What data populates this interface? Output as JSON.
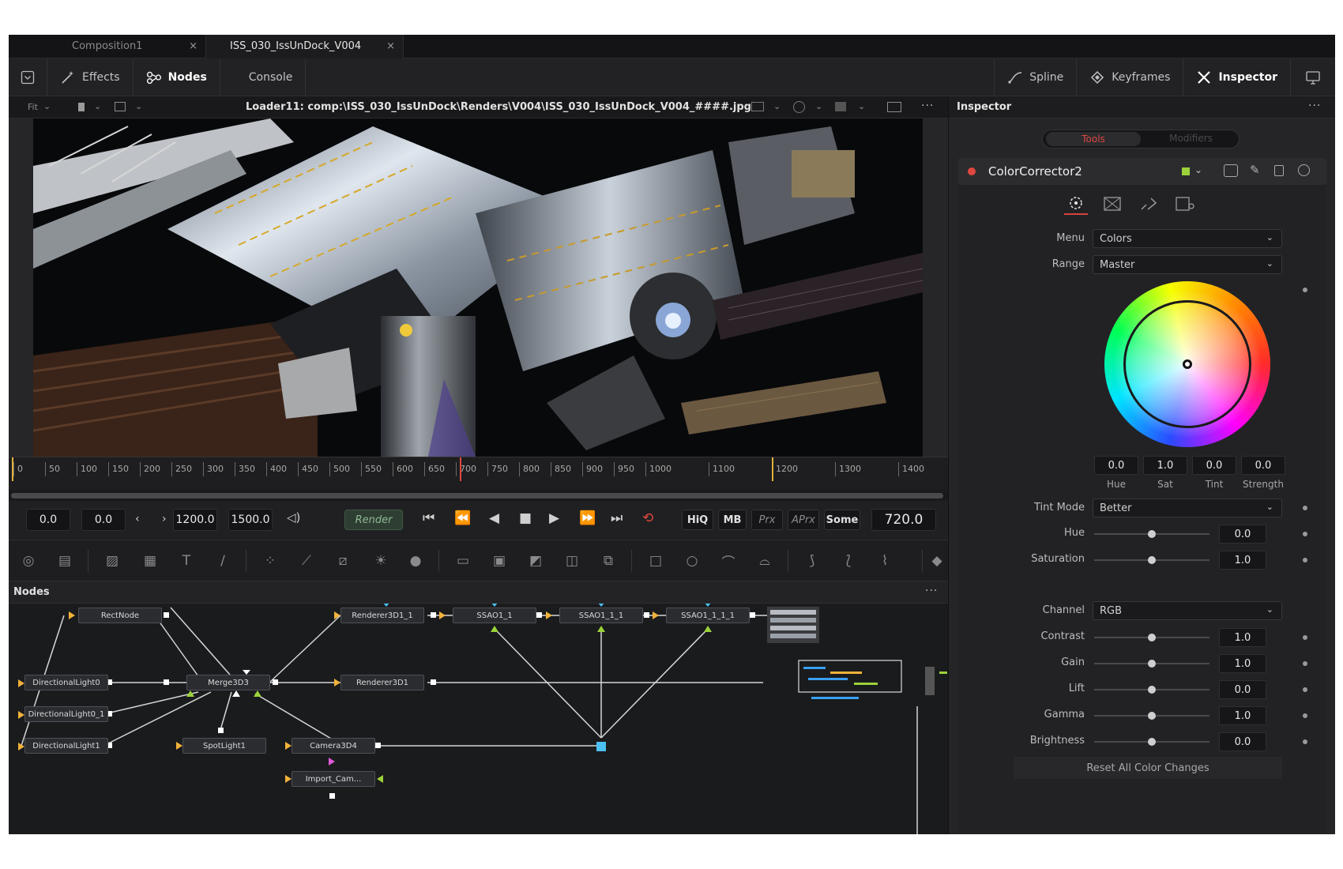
{
  "tabs": [
    {
      "label": "Composition1",
      "close": "×"
    },
    {
      "label": "ISS_030_IssUnDock_V004",
      "close": "×"
    }
  ],
  "toolbar": {
    "effects": "Effects",
    "nodes": "Nodes",
    "console": "Console",
    "spline": "Spline",
    "keyframes": "Keyframes",
    "inspector": "Inspector"
  },
  "viewer": {
    "fit": "Fit",
    "path": "Loader11: comp:\\ISS_030_IssUnDock\\Renders\\V004\\ISS_030_IssUnDock_V004_####.jpg",
    "more": "···"
  },
  "ruler": {
    "ticks": [
      "0",
      "50",
      "100",
      "150",
      "200",
      "250",
      "300",
      "350",
      "400",
      "450",
      "500",
      "550",
      "600",
      "650",
      "700",
      "750",
      "800",
      "850",
      "900",
      "950",
      "1000",
      "1100",
      "1200",
      "1300",
      "1400"
    ]
  },
  "transport": {
    "global_start": "0.0",
    "render_start": "0.0",
    "render_end": "1200.0",
    "global_end": "1500.0",
    "render": "Render",
    "hiq": "HiQ",
    "mb": "MB",
    "prx": "Prx",
    "aprx": "APrx",
    "some": "Some",
    "current_frame": "720.0"
  },
  "nodes_panel": {
    "title": "Nodes",
    "more": "···",
    "nodes": {
      "rect": "RectNode",
      "merge": "Merge3D3",
      "dl0": "DirectionalLight0",
      "dl01": "DirectionalLight0_1",
      "dl1": "DirectionalLight1",
      "spot": "SpotLight1",
      "cam": "Camera3D4",
      "ren1": "Renderer3D1_1",
      "ren2": "Renderer3D1",
      "ssao1": "SSAO1_1",
      "ssao2": "SSAO1_1_1",
      "ssao3": "SSAO1_1_1_1",
      "import": "Import_Cam..."
    }
  },
  "inspector": {
    "title": "Inspector",
    "more": "···",
    "tab_tools": "Tools",
    "tab_modifiers": "Modifiers",
    "tool_name": "ColorCorrector2",
    "menu_label": "Menu",
    "menu_value": "Colors",
    "range_label": "Range",
    "range_value": "Master",
    "wheel": {
      "values": [
        "0.0",
        "1.0",
        "0.0",
        "0.0"
      ],
      "labels": [
        "Hue",
        "Sat",
        "Tint",
        "Strength"
      ]
    },
    "tint_mode_label": "Tint Mode",
    "tint_mode_value": "Better",
    "hue_label": "Hue",
    "hue_value": "0.0",
    "saturation_label": "Saturation",
    "saturation_value": "1.0",
    "channel_label": "Channel",
    "channel_value": "RGB",
    "contrast_label": "Contrast",
    "contrast_value": "1.0",
    "gain_label": "Gain",
    "gain_value": "1.0",
    "lift_label": "Lift",
    "lift_value": "0.0",
    "gamma_label": "Gamma",
    "gamma_value": "1.0",
    "brightness_label": "Brightness",
    "brightness_value": "0.0",
    "reset": "Reset All Color Changes"
  },
  "icons": {
    "close": "×",
    "chevron": "⌄"
  }
}
